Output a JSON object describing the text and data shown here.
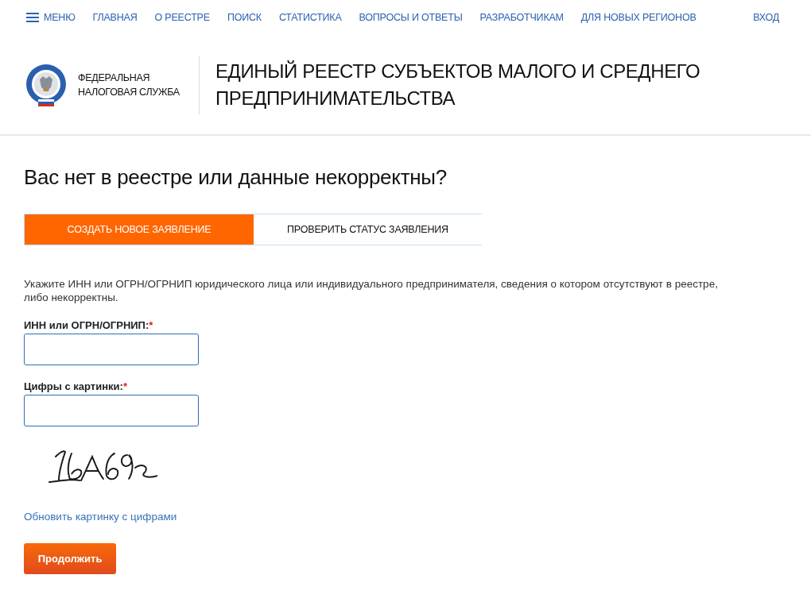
{
  "nav": {
    "menu": {
      "label": "МЕНЮ"
    },
    "items": [
      {
        "label": "ГЛАВНАЯ"
      },
      {
        "label": "О РЕЕСТРЕ"
      },
      {
        "label": "ПОИСК"
      },
      {
        "label": "СТАТИСТИКА"
      },
      {
        "label": "ВОПРОСЫ И ОТВЕТЫ"
      },
      {
        "label": "РАЗРАБОТЧИКАМ"
      },
      {
        "label": "ДЛЯ НОВЫХ РЕГИОНОВ"
      }
    ],
    "login": "ВХОД"
  },
  "header": {
    "org_name": "ФЕДЕРАЛЬНАЯ НАЛОГОВАЯ СЛУЖБА",
    "title": "ЕДИНЫЙ РЕЕСТР СУБЪЕКТОВ МАЛОГО И СРЕДНЕГО ПРЕДПРИНИМАТЕЛЬСТВА"
  },
  "page_title": "Вас нет в реестре или данные некорректны?",
  "tabs": [
    {
      "label": "СОЗДАТЬ НОВОЕ ЗАЯВЛЕНИЕ",
      "selected": true
    },
    {
      "label": "ПРОВЕРИТЬ СТАТУС ЗАЯВЛЕНИЯ",
      "selected": false
    }
  ],
  "form": {
    "instructions": "Укажите ИНН или ОГРН/ОГРНИП юридического лица или индивидуального предпринимателя, сведения о котором отсутствуют в реестре, либо некорректны.",
    "fields": [
      {
        "label": "ИНН или ОГРН/ОГРНИП:",
        "required_mark": "*"
      },
      {
        "label": "Цифры с картинки:",
        "required_mark": "*"
      }
    ],
    "refresh_link": "Обновить картинку с цифрами",
    "submit": "Продолжить"
  }
}
